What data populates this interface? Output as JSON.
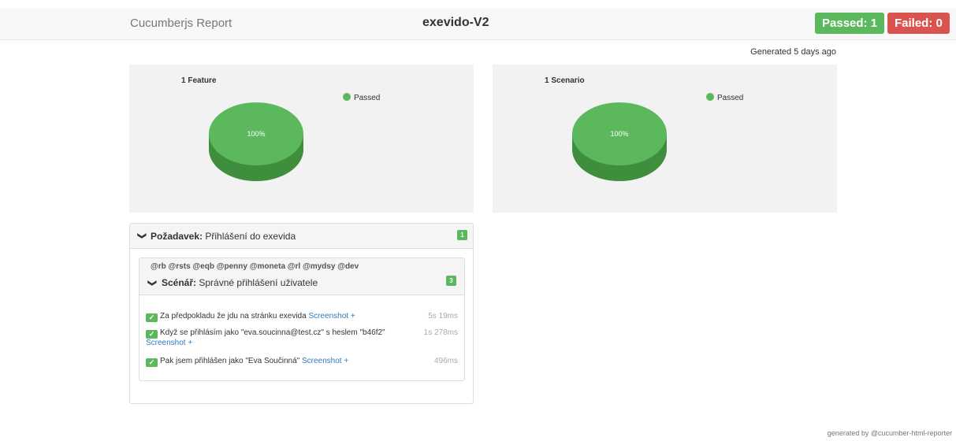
{
  "header": {
    "brand": "Cucumberjs Report",
    "project": "exevido-V2",
    "passed_badge": "Passed: 1",
    "failed_badge": "Failed: 0"
  },
  "generated_text": "Generated 5 days ago",
  "charts": [
    {
      "title": "1 Feature",
      "legend": "Passed",
      "slice_label": "100%"
    },
    {
      "title": "1 Scenario",
      "legend": "Passed",
      "slice_label": "100%"
    }
  ],
  "chart_data": [
    {
      "type": "pie",
      "title": "1 Feature",
      "categories": [
        "Passed"
      ],
      "values": [
        100
      ],
      "legend": "top-right",
      "colors": [
        "#5cb85c"
      ]
    },
    {
      "type": "pie",
      "title": "1 Scenario",
      "categories": [
        "Passed"
      ],
      "values": [
        100
      ],
      "legend": "top-right",
      "colors": [
        "#5cb85c"
      ]
    }
  ],
  "feature": {
    "keyword": "Požadavek:",
    "name": "Přihlášení do exevida",
    "count": "1",
    "scenario": {
      "tags": "@rb @rsts @eqb @penny @moneta @rl @mydsy @dev",
      "keyword": "Scénář:",
      "name": "Správné přihlášení uživatele",
      "count": "3",
      "steps": [
        {
          "text": "Za předpokladu že jdu na stránku exevida",
          "link": "Screenshot +",
          "duration": "5s 19ms"
        },
        {
          "text": "Když se přihlásím jako \"eva.soucinna@test.cz\" s heslem \"b46f2\"",
          "link": "Screenshot +",
          "duration": "1s 278ms"
        },
        {
          "text": "Pak jsem přihlášen jako \"Eva Součinná\"",
          "link": "Screenshot +",
          "duration": "496ms"
        }
      ]
    }
  },
  "footer": "generated by @cucumber-html-reporter",
  "colors": {
    "passed": "#5cb85c",
    "failed": "#d9534f",
    "link": "#337ab7"
  }
}
